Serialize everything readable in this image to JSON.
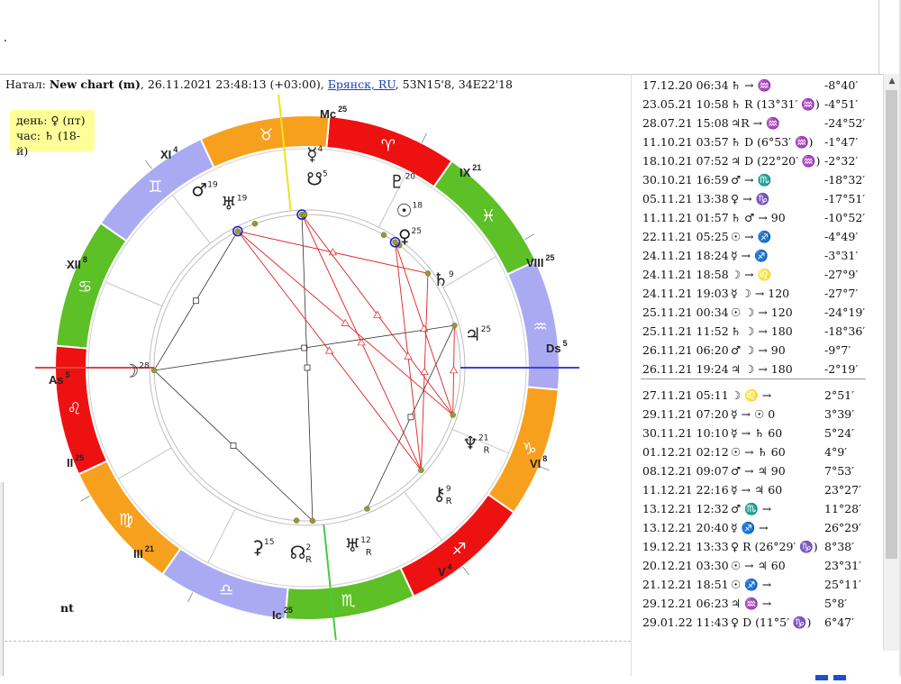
{
  "header": {
    "prefix": "Натал:",
    "chart_name": "New chart (m)",
    "datetime": ", 26.11.2021 23:48:13 (+03:00), ",
    "city": "Брянск, RU",
    "coords": ", 53N15'8, 34E22'18"
  },
  "day_box": {
    "day": "день: ♀ (пт)",
    "hour": "час: ♄ (18-й)"
  },
  "footer_label": "nt",
  "colors": {
    "fire": "#ee1111",
    "earth": "#f7a01e",
    "air": "#aaaaf2",
    "water": "#5dc026",
    "asc_line": "#e44444",
    "dsc_line": "#4040e0",
    "mc_line": "#f0e020",
    "ic_line": "#44cc44"
  },
  "houses": [
    "I",
    "II",
    "III",
    "IV",
    "V",
    "VI",
    "VII",
    "VIII",
    "IX",
    "X",
    "XI",
    "XII"
  ],
  "house_labels": [
    {
      "name": "As",
      "deg": "5"
    },
    {
      "name": "II",
      "deg": "25"
    },
    {
      "name": "III",
      "deg": "21"
    },
    {
      "name": "Ic",
      "deg": "25"
    },
    {
      "name": "V",
      "deg": "4"
    },
    {
      "name": "VI",
      "deg": "8"
    },
    {
      "name": "Ds",
      "deg": "5"
    },
    {
      "name": "VIII",
      "deg": "25"
    },
    {
      "name": "IX",
      "deg": "21"
    },
    {
      "name": "Mc",
      "deg": "25"
    },
    {
      "name": "XI",
      "deg": "4"
    },
    {
      "name": "XII",
      "deg": "8"
    }
  ],
  "zodiac": [
    {
      "glyph": "♈",
      "element": "fire"
    },
    {
      "glyph": "♉",
      "element": "earth"
    },
    {
      "glyph": "♊",
      "element": "air"
    },
    {
      "glyph": "♋",
      "element": "water"
    },
    {
      "glyph": "♌",
      "element": "fire"
    },
    {
      "glyph": "♍",
      "element": "earth"
    },
    {
      "glyph": "♎",
      "element": "air"
    },
    {
      "glyph": "♏",
      "element": "water"
    },
    {
      "glyph": "♐",
      "element": "fire"
    },
    {
      "glyph": "♑",
      "element": "earth"
    },
    {
      "glyph": "♒",
      "element": "air"
    },
    {
      "glyph": "♓",
      "element": "water"
    }
  ],
  "planets": [
    {
      "id": "moon",
      "glyph": "☽",
      "deg": "28",
      "retro": ""
    },
    {
      "id": "ceres",
      "glyph": "⚳",
      "deg": "15",
      "retro": ""
    },
    {
      "id": "node",
      "glyph": "☊",
      "deg": "2",
      "retro": "R"
    },
    {
      "id": "uranus-a",
      "glyph": "♅",
      "deg": "12",
      "retro": "R"
    },
    {
      "id": "chiron",
      "glyph": "⚷",
      "deg": "9",
      "retro": "R"
    },
    {
      "id": "neptune",
      "glyph": "♆",
      "deg": "21",
      "retro": "R"
    },
    {
      "id": "jupiter",
      "glyph": "♃",
      "deg": "25",
      "retro": ""
    },
    {
      "id": "saturn",
      "glyph": "♄",
      "deg": "9",
      "retro": ""
    },
    {
      "id": "venus",
      "glyph": "♀",
      "deg": "25",
      "retro": ""
    },
    {
      "id": "sun",
      "glyph": "☉",
      "deg": "18",
      "retro": ""
    },
    {
      "id": "pluto",
      "glyph": "♇",
      "deg": "20",
      "retro": ""
    },
    {
      "id": "uranus",
      "glyph": "♅",
      "deg": "19",
      "retro": ""
    },
    {
      "id": "mars",
      "glyph": "♂",
      "deg": "19",
      "retro": ""
    },
    {
      "id": "south-node",
      "glyph": "☋",
      "deg": "5",
      "retro": ""
    },
    {
      "id": "mercury",
      "glyph": "☿",
      "deg": "4",
      "retro": ""
    }
  ],
  "events_past": [
    {
      "date": "17.12.20 06:34",
      "aspect": "♄  → ♒",
      "value": "-8°40′"
    },
    {
      "date": "23.05.21 10:58",
      "aspect": "♄  R (13°31′ ♒)",
      "value": "-4°51′"
    },
    {
      "date": "28.07.21 15:08",
      "aspect": "♃R → ♒",
      "value": "-24°52′"
    },
    {
      "date": "11.10.21 03:57",
      "aspect": "♄  D (6°53′ ♒)",
      "value": "-1°47′"
    },
    {
      "date": "18.10.21 07:52",
      "aspect": "♃  D (22°20′ ♒)",
      "value": "-2°32′"
    },
    {
      "date": "30.10.21 16:59",
      "aspect": "♂  → ♏",
      "value": "-18°32′"
    },
    {
      "date": "05.11.21 13:38",
      "aspect": "♀  → ♑",
      "value": "-17°51′"
    },
    {
      "date": "11.11.21 01:57",
      "aspect": "♄  ♂  → 90",
      "value": "-10°52′"
    },
    {
      "date": "22.11.21 05:25",
      "aspect": "☉  → ♐",
      "value": "-4°49′"
    },
    {
      "date": "24.11.21 18:24",
      "aspect": "☿  → ♐",
      "value": "-3°31′"
    },
    {
      "date": "24.11.21 18:58",
      "aspect": "☽  → ♌",
      "value": "-27°9′"
    },
    {
      "date": "24.11.21 19:03",
      "aspect": "☿  ☽  → 120",
      "value": "-27°7′"
    },
    {
      "date": "25.11.21 00:34",
      "aspect": "☉  ☽  → 120",
      "value": "-24°19′"
    },
    {
      "date": "25.11.21 11:52",
      "aspect": "♄  ☽  → 180",
      "value": "-18°36′"
    },
    {
      "date": "26.11.21 06:20",
      "aspect": "♂  ☽  → 90",
      "value": "-9°7′"
    },
    {
      "date": "26.11.21 19:24",
      "aspect": "♃  ☽  → 180",
      "value": "-2°19′"
    }
  ],
  "events_future": [
    {
      "date": "27.11.21 05:11",
      "aspect": "☽  ♌ →",
      "value": "2°51′"
    },
    {
      "date": "29.11.21 07:20",
      "aspect": "☿  → ☉  0",
      "value": "3°39′"
    },
    {
      "date": "30.11.21 10:10",
      "aspect": "☿  → ♄  60",
      "value": "5°24′"
    },
    {
      "date": "01.12.21 02:12",
      "aspect": "☉  → ♄  60",
      "value": "4°9′"
    },
    {
      "date": "08.12.21 09:07",
      "aspect": "♂  → ♃  90",
      "value": "7°53′"
    },
    {
      "date": "11.12.21 22:16",
      "aspect": "☿  → ♃  60",
      "value": "23°27′"
    },
    {
      "date": "13.12.21 12:32",
      "aspect": "♂  ♏ →",
      "value": "11°28′"
    },
    {
      "date": "13.12.21 20:40",
      "aspect": "☿  ♐ →",
      "value": "26°29′"
    },
    {
      "date": "19.12.21 13:33",
      "aspect": "♀  R (26°29′ ♑)",
      "value": "8°38′"
    },
    {
      "date": "20.12.21 03:30",
      "aspect": "☉  → ♃  60",
      "value": "23°31′"
    },
    {
      "date": "21.12.21 18:51",
      "aspect": "☉  ♐ →",
      "value": "25°11′"
    },
    {
      "date": "29.12.21 06:23",
      "aspect": "♃  ♒ →",
      "value": "5°8′"
    },
    {
      "date": "29.01.22 11:43",
      "aspect": "♀  D (11°5′ ♑)",
      "value": "6°47′"
    }
  ],
  "scroll": {
    "up": "▲",
    "down": "▼"
  }
}
